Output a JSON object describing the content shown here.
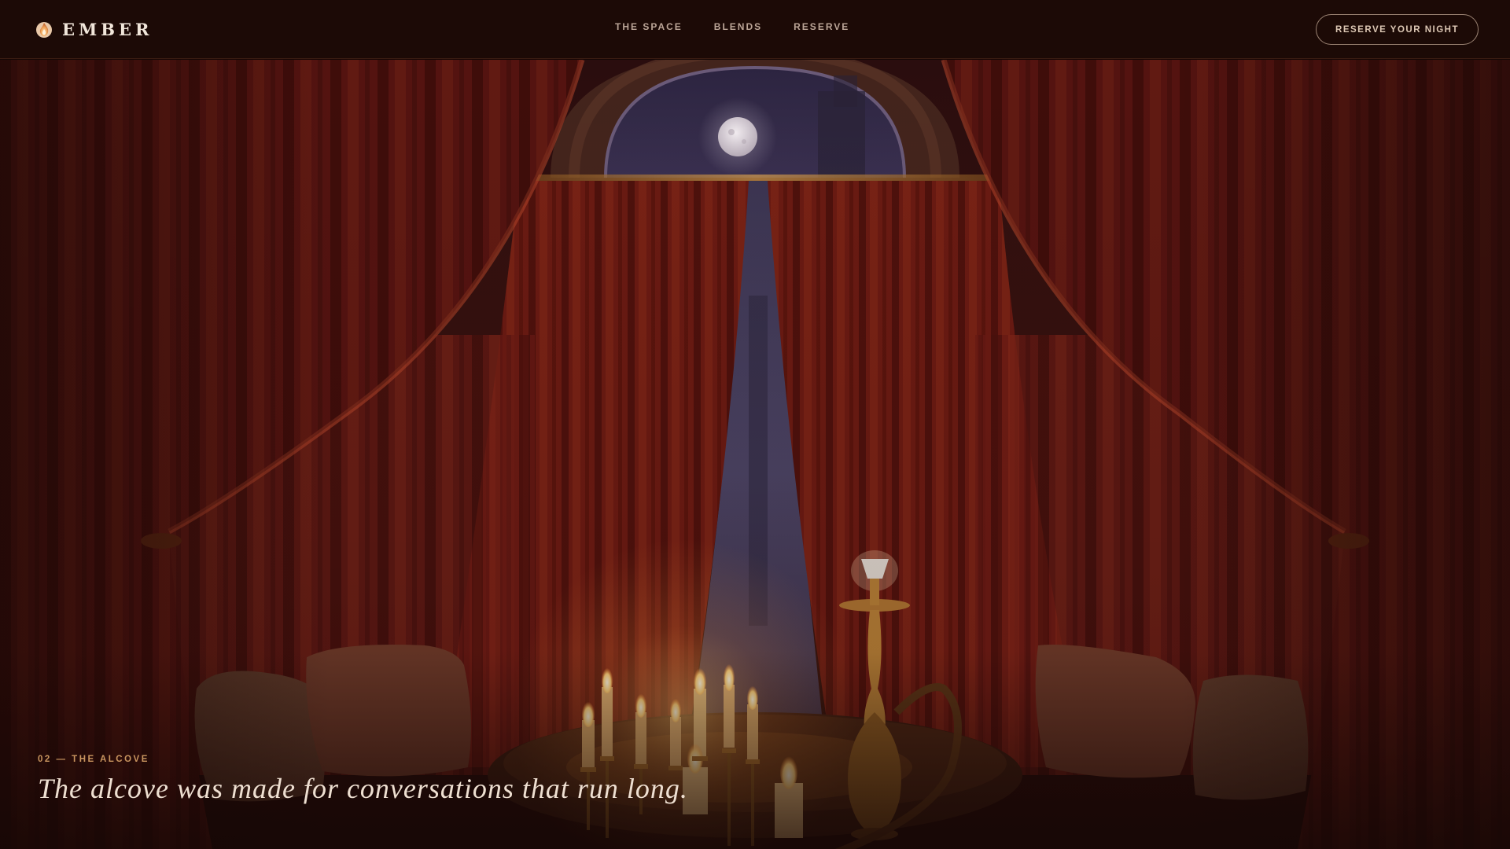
{
  "brand": {
    "name": "EMBER",
    "icon": "flame-icon"
  },
  "nav": {
    "links": [
      "THE SPACE",
      "BLENDS",
      "RESERVE"
    ],
    "cta_label": "RESERVE YOUR NIGHT"
  },
  "hero": {
    "eyebrow": "02 — THE ALCOVE",
    "headline": "The alcove was made for conversations that run long.",
    "scene": {
      "icons": [
        "moon-icon",
        "curtain-icon",
        "candle-icon",
        "hookah-icon",
        "cushion-icon"
      ]
    }
  },
  "colors": {
    "background": "#150705",
    "nav_bg": "#1c0a06",
    "curtain": "#7a1f14",
    "candle_glow": "#ffc86e",
    "accent_gold": "#c9955f",
    "text_light": "#eedfd1",
    "text_muted": "#bba597"
  }
}
